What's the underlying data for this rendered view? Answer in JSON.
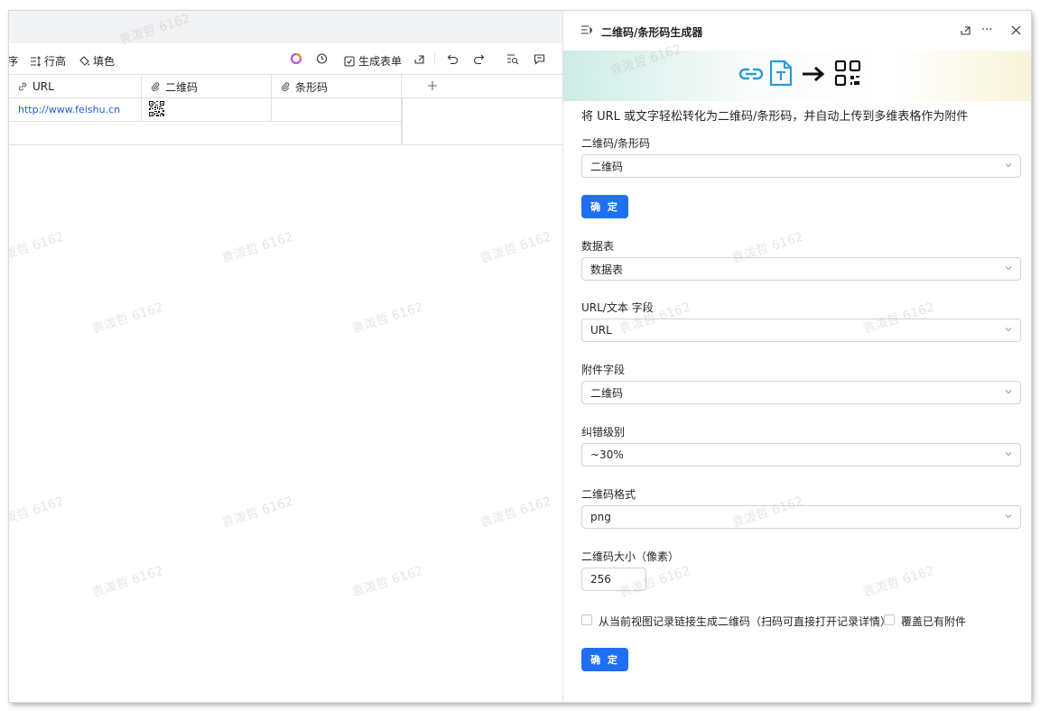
{
  "toolbar": {
    "cut_label": "序",
    "row_height_label": "行高",
    "fill_color_label": "填色",
    "generate_form_label": "生成表单"
  },
  "grid": {
    "columns": [
      "URL",
      "二维码",
      "条形码"
    ],
    "rows": [
      {
        "url": "http://www.feishu.cn"
      }
    ]
  },
  "watermark": "袁泼哲 6162",
  "panel": {
    "title": "二维码/条形码生成器",
    "description": "将 URL 或文字轻松转化为二维码/条形码，并自动上传到多维表格作为附件",
    "type_label": "二维码/条形码",
    "type_value": "二维码",
    "confirm_label": "确 定",
    "table_label": "数据表",
    "table_value": "数据表",
    "field_label": "URL/文本 字段",
    "field_value": "URL",
    "attach_label": "附件字段",
    "attach_value": "二维码",
    "ecc_label": "纠错级别",
    "ecc_value": "~30%",
    "format_label": "二维码格式",
    "format_value": "png",
    "size_label": "二维码大小（像素）",
    "size_value": "256",
    "record_link_label": "从当前视图记录链接生成二维码（扫码可直接打开记录详情）",
    "overwrite_label": "覆盖已有附件",
    "submit_label": "确 定"
  },
  "colors": {
    "primary": "#1f6ff2",
    "link": "#245bdb",
    "accent_icon": "#2a9ad8"
  }
}
